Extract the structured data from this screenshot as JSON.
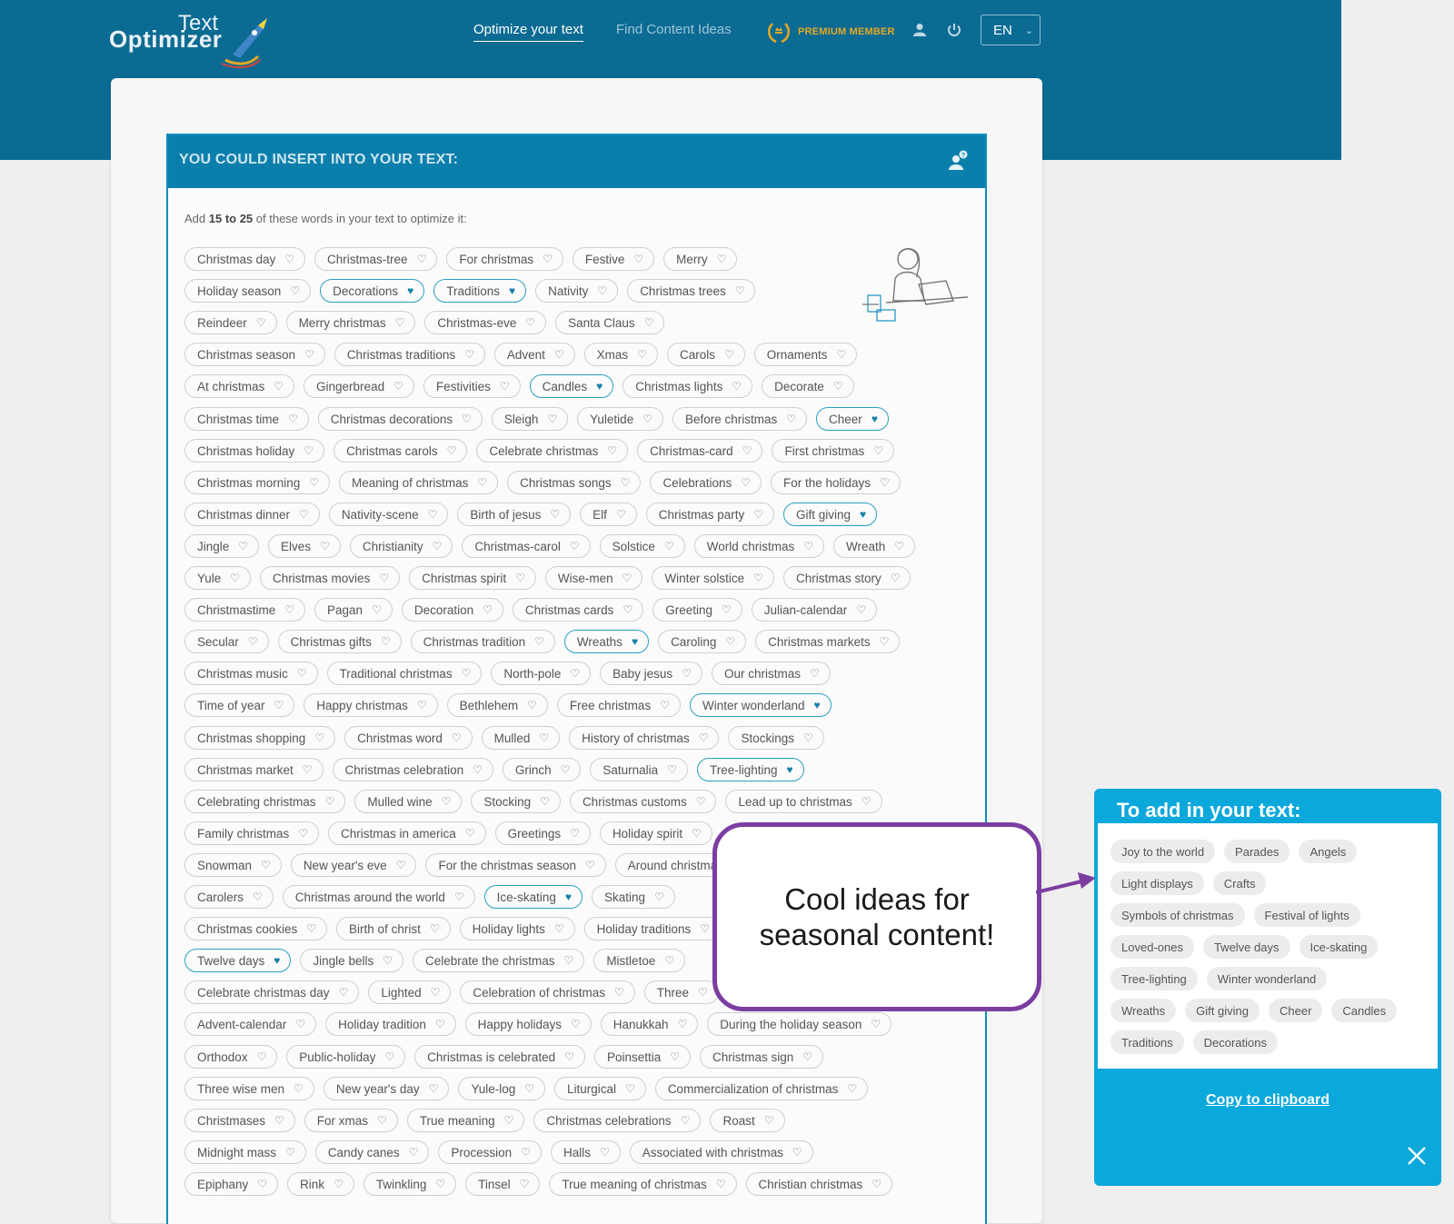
{
  "header": {
    "logo_text_top": "Text",
    "logo_text_bottom": "Optimizer",
    "nav": [
      {
        "label": "Optimize your text",
        "active": true
      },
      {
        "label": "Find Content Ideas",
        "active": false
      }
    ],
    "premium_label": "PREMIUM MEMBER",
    "user_icon": "user-icon",
    "power_icon": "power-icon",
    "language": "EN"
  },
  "panel": {
    "title": "YOU COULD INSERT INTO YOUR TEXT:",
    "intro_prefix": "Add ",
    "intro_bold": "15 to 25",
    "intro_suffix": " of these words in your text to optimize it:"
  },
  "tag_rows": [
    [
      {
        "label": "Christmas day"
      },
      {
        "label": "Christmas-tree"
      },
      {
        "label": "For christmas"
      },
      {
        "label": "Festive"
      },
      {
        "label": "Merry"
      }
    ],
    [
      {
        "label": "Holiday season"
      },
      {
        "label": "Decorations",
        "selected": true
      },
      {
        "label": "Traditions",
        "selected": true
      },
      {
        "label": "Nativity"
      },
      {
        "label": "Christmas trees"
      }
    ],
    [
      {
        "label": "Reindeer"
      },
      {
        "label": "Merry christmas"
      },
      {
        "label": "Christmas-eve"
      },
      {
        "label": "Santa Claus"
      }
    ],
    [
      {
        "label": "Christmas season"
      },
      {
        "label": "Christmas traditions"
      },
      {
        "label": "Advent"
      },
      {
        "label": "Xmas"
      },
      {
        "label": "Carols"
      },
      {
        "label": "Ornaments"
      }
    ],
    [
      {
        "label": "At christmas"
      },
      {
        "label": "Gingerbread"
      },
      {
        "label": "Festivities"
      },
      {
        "label": "Candles",
        "selected": true
      },
      {
        "label": "Christmas lights"
      },
      {
        "label": "Decorate"
      }
    ],
    [
      {
        "label": "Christmas time"
      },
      {
        "label": "Christmas decorations"
      },
      {
        "label": "Sleigh"
      },
      {
        "label": "Yuletide"
      },
      {
        "label": "Before christmas"
      },
      {
        "label": "Cheer",
        "selected": true
      }
    ],
    [
      {
        "label": "Christmas holiday"
      },
      {
        "label": "Christmas carols"
      },
      {
        "label": "Celebrate christmas"
      },
      {
        "label": "Christmas-card"
      },
      {
        "label": "First christmas"
      }
    ],
    [
      {
        "label": "Christmas morning"
      },
      {
        "label": "Meaning of christmas"
      },
      {
        "label": "Christmas songs"
      },
      {
        "label": "Celebrations"
      },
      {
        "label": "For the holidays"
      }
    ],
    [
      {
        "label": "Christmas dinner"
      },
      {
        "label": "Nativity-scene"
      },
      {
        "label": "Birth of jesus"
      },
      {
        "label": "Elf"
      },
      {
        "label": "Christmas party"
      },
      {
        "label": "Gift giving",
        "selected": true
      }
    ],
    [
      {
        "label": "Jingle"
      },
      {
        "label": "Elves"
      },
      {
        "label": "Christianity"
      },
      {
        "label": "Christmas-carol"
      },
      {
        "label": "Solstice"
      },
      {
        "label": "World christmas"
      },
      {
        "label": "Wreath"
      }
    ],
    [
      {
        "label": "Yule"
      },
      {
        "label": "Christmas movies"
      },
      {
        "label": "Christmas spirit"
      },
      {
        "label": "Wise-men"
      },
      {
        "label": "Winter solstice"
      },
      {
        "label": "Christmas story"
      }
    ],
    [
      {
        "label": "Christmastime"
      },
      {
        "label": "Pagan"
      },
      {
        "label": "Decoration"
      },
      {
        "label": "Christmas cards"
      },
      {
        "label": "Greeting"
      },
      {
        "label": "Julian-calendar"
      }
    ],
    [
      {
        "label": "Secular"
      },
      {
        "label": "Christmas gifts"
      },
      {
        "label": "Christmas tradition"
      },
      {
        "label": "Wreaths",
        "selected": true
      },
      {
        "label": "Caroling"
      },
      {
        "label": "Christmas markets"
      }
    ],
    [
      {
        "label": "Christmas music"
      },
      {
        "label": "Traditional christmas"
      },
      {
        "label": "North-pole"
      },
      {
        "label": "Baby jesus"
      },
      {
        "label": "Our christmas"
      }
    ],
    [
      {
        "label": "Time of year"
      },
      {
        "label": "Happy christmas"
      },
      {
        "label": "Bethlehem"
      },
      {
        "label": "Free christmas"
      },
      {
        "label": "Winter wonderland",
        "selected": true
      }
    ],
    [
      {
        "label": "Christmas shopping"
      },
      {
        "label": "Christmas word"
      },
      {
        "label": "Mulled"
      },
      {
        "label": "History of christmas"
      },
      {
        "label": "Stockings"
      }
    ],
    [
      {
        "label": "Christmas market"
      },
      {
        "label": "Christmas celebration"
      },
      {
        "label": "Grinch"
      },
      {
        "label": "Saturnalia"
      },
      {
        "label": "Tree-lighting",
        "selected": true
      }
    ],
    [
      {
        "label": "Celebrating christmas"
      },
      {
        "label": "Mulled wine"
      },
      {
        "label": "Stocking"
      },
      {
        "label": "Christmas customs"
      },
      {
        "label": "Lead up to christmas"
      }
    ],
    [
      {
        "label": "Family christmas"
      },
      {
        "label": "Christmas in america"
      },
      {
        "label": "Greetings"
      },
      {
        "label": "Holiday spirit"
      }
    ],
    [
      {
        "label": "Snowman"
      },
      {
        "label": "New year's eve"
      },
      {
        "label": "For the christmas season"
      },
      {
        "label": "Around christmas"
      }
    ],
    [
      {
        "label": "Carolers"
      },
      {
        "label": "Christmas around the world"
      },
      {
        "label": "Ice-skating",
        "selected": true
      },
      {
        "label": "Skating"
      }
    ],
    [
      {
        "label": "Christmas cookies"
      },
      {
        "label": "Birth of christ"
      },
      {
        "label": "Holiday lights"
      },
      {
        "label": "Holiday traditions"
      }
    ],
    [
      {
        "label": "Twelve days",
        "selected": true
      },
      {
        "label": "Jingle bells"
      },
      {
        "label": "Celebrate the christmas"
      },
      {
        "label": "Mistletoe"
      }
    ],
    [
      {
        "label": "Celebrate christmas day"
      },
      {
        "label": "Lighted"
      },
      {
        "label": "Celebration of christmas"
      },
      {
        "label": "Three"
      }
    ],
    [
      {
        "label": "Advent-calendar"
      },
      {
        "label": "Holiday tradition"
      },
      {
        "label": "Happy holidays"
      },
      {
        "label": "Hanukkah"
      },
      {
        "label": "During the holiday season"
      }
    ],
    [
      {
        "label": "Orthodox"
      },
      {
        "label": "Public-holiday"
      },
      {
        "label": "Christmas is celebrated"
      },
      {
        "label": "Poinsettia"
      },
      {
        "label": "Christmas sign"
      }
    ],
    [
      {
        "label": "Three wise men"
      },
      {
        "label": "New year's day"
      },
      {
        "label": "Yule-log"
      },
      {
        "label": "Liturgical"
      },
      {
        "label": "Commercialization of christmas"
      }
    ],
    [
      {
        "label": "Christmases"
      },
      {
        "label": "For xmas"
      },
      {
        "label": "True meaning"
      },
      {
        "label": "Christmas celebrations"
      },
      {
        "label": "Roast"
      }
    ],
    [
      {
        "label": "Midnight mass"
      },
      {
        "label": "Candy canes"
      },
      {
        "label": "Procession"
      },
      {
        "label": "Halls"
      },
      {
        "label": "Associated with christmas"
      }
    ],
    [
      {
        "label": "Epiphany"
      },
      {
        "label": "Rink"
      },
      {
        "label": "Twinkling"
      },
      {
        "label": "Tinsel"
      },
      {
        "label": "True meaning of christmas"
      },
      {
        "label": "Christian christmas"
      }
    ]
  ],
  "callout": {
    "text": "Cool ideas for seasonal content!"
  },
  "sidebar": {
    "title": "To add in your text:",
    "chip_rows": [
      [
        "Joy to the world",
        "Parades",
        "Angels"
      ],
      [
        "Light displays",
        "Crafts"
      ],
      [
        "Symbols of christmas",
        "Festival of lights"
      ],
      [
        "Loved-ones",
        "Twelve days",
        "Ice-skating"
      ],
      [
        "Tree-lighting",
        "Winter wonderland"
      ],
      [
        "Wreaths",
        "Gift giving",
        "Cheer",
        "Candles"
      ],
      [
        "Traditions",
        "Decorations"
      ]
    ],
    "copy_label": "Copy to clipboard"
  },
  "colors": {
    "header_blue": "#0b6b93",
    "panel_blue": "#0b7fab",
    "sidebar_blue": "#0ba8db",
    "premium_gold": "#e5a823",
    "callout_purple": "#7b3ea0",
    "selected_border": "#2a9fc4"
  }
}
